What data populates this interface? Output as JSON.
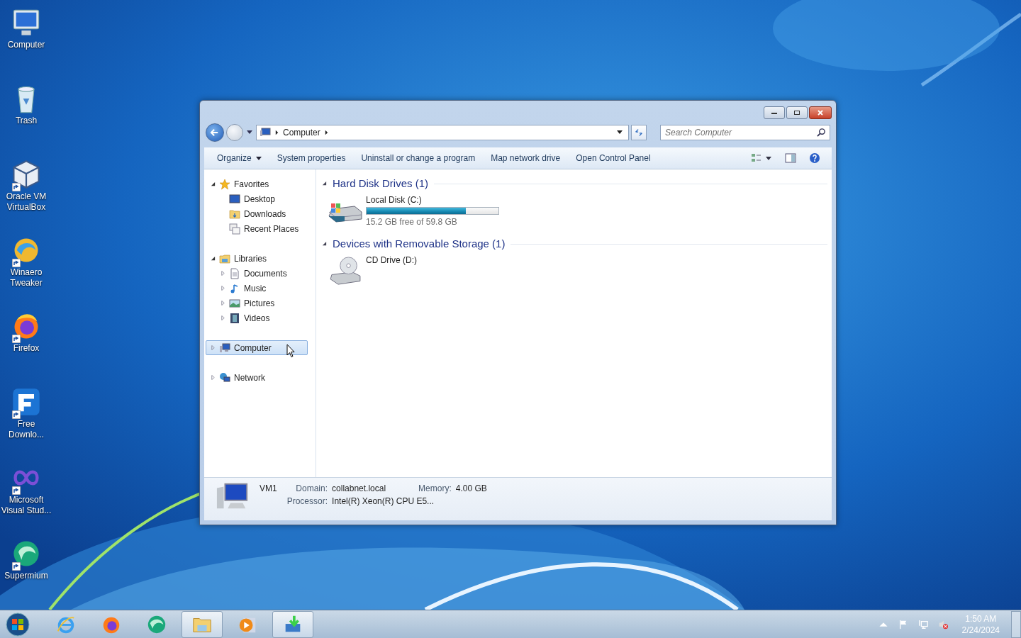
{
  "desktop_icons": [
    {
      "label": "Computer",
      "shortcut": false
    },
    {
      "label": "Trash",
      "shortcut": false
    },
    {
      "label": "Oracle VM VirtualBox",
      "shortcut": true
    },
    {
      "label": "Winaero Tweaker",
      "shortcut": true
    },
    {
      "label": "Firefox",
      "shortcut": true
    },
    {
      "label": "Free Downlo...",
      "shortcut": true
    },
    {
      "label": "Microsoft Visual Stud...",
      "shortcut": true
    },
    {
      "label": "Supermium",
      "shortcut": true
    }
  ],
  "window": {
    "address": {
      "crumbs": [
        "Computer"
      ]
    },
    "search": {
      "placeholder": "Search Computer"
    },
    "toolbar": [
      {
        "label": "Organize",
        "dropdown": true
      },
      {
        "label": "System properties",
        "dropdown": false
      },
      {
        "label": "Uninstall or change a program",
        "dropdown": false
      },
      {
        "label": "Map network drive",
        "dropdown": false
      },
      {
        "label": "Open Control Panel",
        "dropdown": false
      }
    ],
    "nav_tree": [
      {
        "label": "Favorites",
        "expanded": true,
        "selected": false,
        "children": [
          {
            "label": "Desktop",
            "selected": false
          },
          {
            "label": "Downloads",
            "selected": false
          },
          {
            "label": "Recent Places",
            "selected": false
          }
        ]
      },
      {
        "label": "Libraries",
        "expanded": true,
        "selected": false,
        "children": [
          {
            "label": "Documents",
            "expanded": false,
            "selected": false
          },
          {
            "label": "Music",
            "expanded": false,
            "selected": false
          },
          {
            "label": "Pictures",
            "expanded": false,
            "selected": false
          },
          {
            "label": "Videos",
            "expanded": false,
            "selected": false
          }
        ]
      },
      {
        "label": "Computer",
        "expanded": false,
        "selected": true
      },
      {
        "label": "Network",
        "expanded": false,
        "selected": false
      }
    ],
    "groups": [
      {
        "title": "Hard Disk Drives (1)",
        "expanded": true,
        "items": [
          {
            "kind": "disk",
            "name": "Local Disk (C:)",
            "level": 0.75,
            "reading": "15.2 GB free of 59.8 GB"
          }
        ]
      },
      {
        "title": "Devices with Removable Storage (1)",
        "expanded": true,
        "items": [
          {
            "kind": "cd",
            "name": "CD Drive (D:)"
          }
        ]
      }
    ],
    "details": {
      "name": "VM1",
      "fields": [
        {
          "label": "Domain:",
          "value": "collabnet.local"
        },
        {
          "label": "Memory:",
          "value": "4.00 GB"
        },
        {
          "label": "Processor:",
          "value": "Intel(R) Xeon(R) CPU E5..."
        }
      ]
    }
  },
  "taskbar": {
    "apps": [
      {
        "active": false
      },
      {
        "active": false
      },
      {
        "active": false
      },
      {
        "active": true
      },
      {
        "active": false
      },
      {
        "active": true
      }
    ],
    "time": "1:50 AM",
    "date": "2/24/2024"
  }
}
